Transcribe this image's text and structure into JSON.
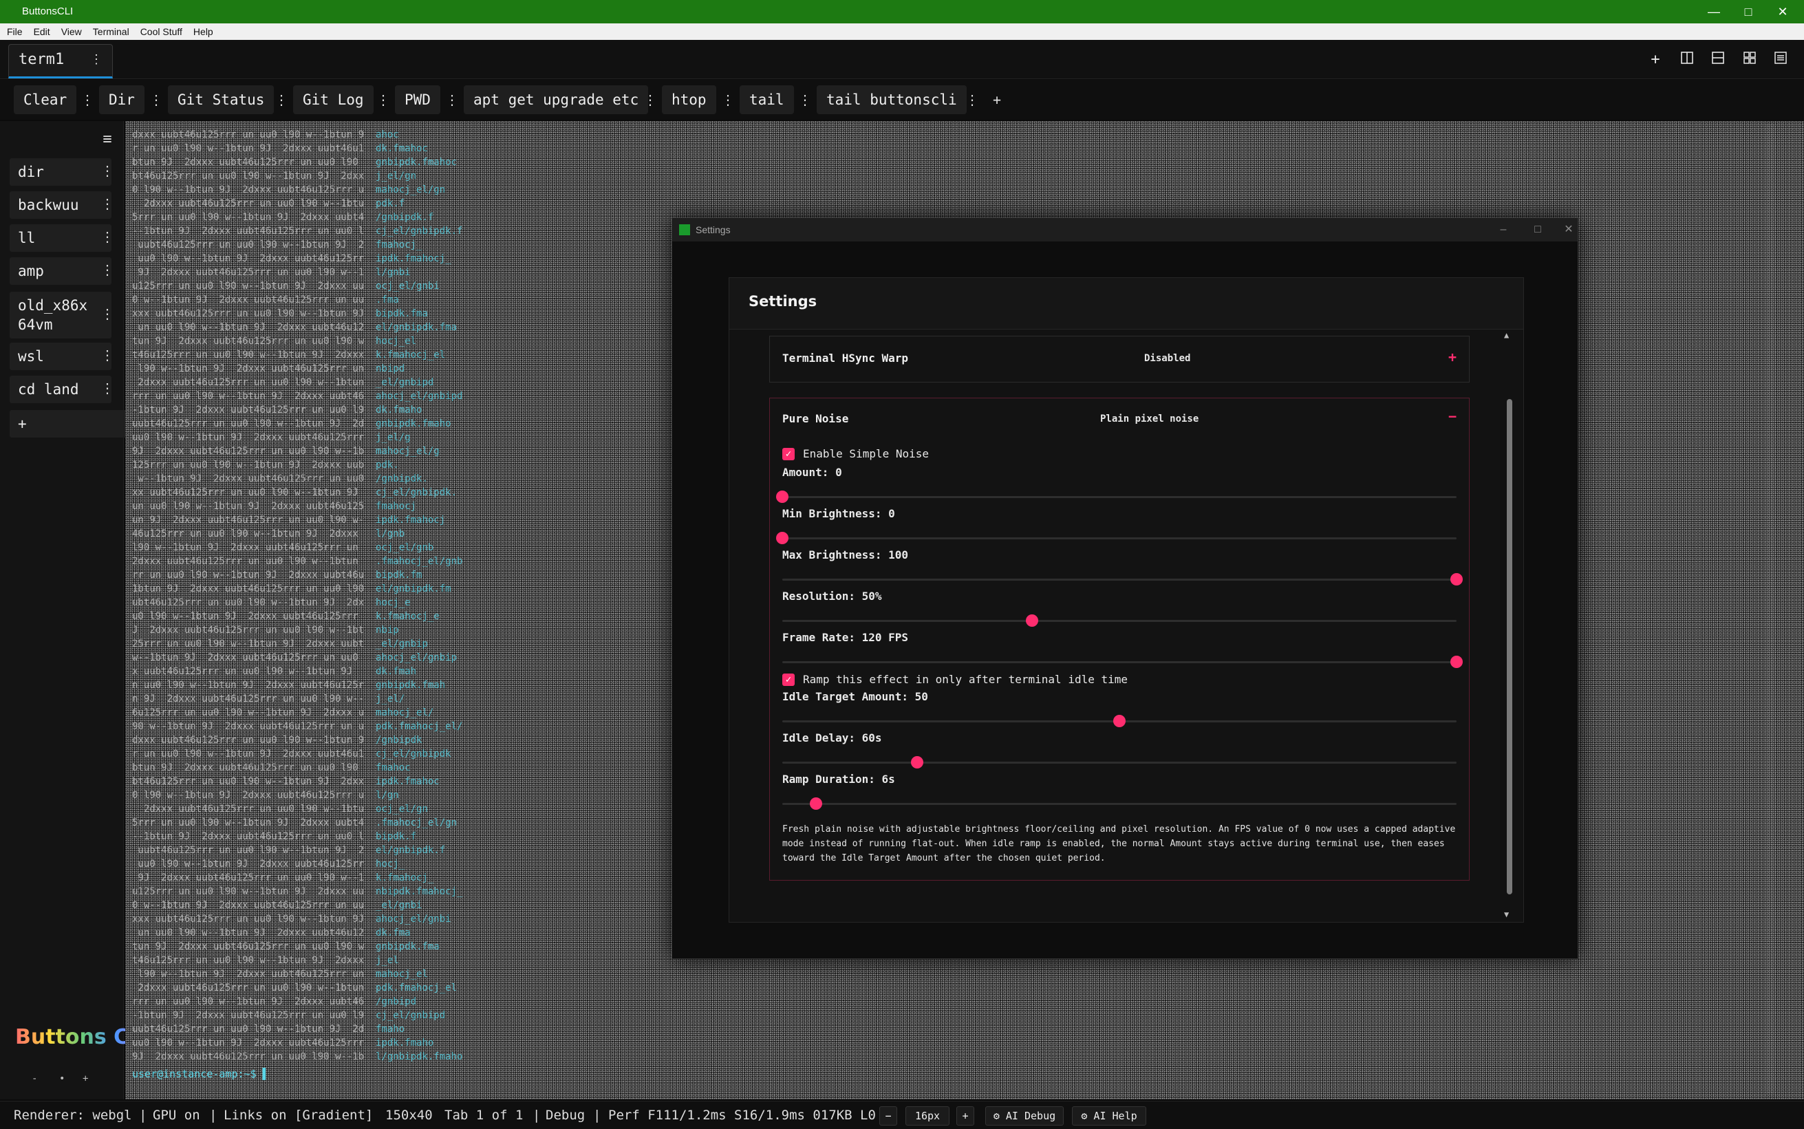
{
  "window": {
    "title": "ButtonsCLI",
    "controls": [
      "—",
      "□",
      "✕"
    ]
  },
  "menu": [
    "File",
    "Edit",
    "View",
    "Terminal",
    "Cool Stuff",
    "Help"
  ],
  "tabs": [
    {
      "label": "term1",
      "menu": "⋮"
    }
  ],
  "toolbar_icons": [
    "new-tab-icon",
    "split-vertical-icon",
    "split-horizontal-icon",
    "grid-layout-icon",
    "settings-list-icon"
  ],
  "buttons": [
    {
      "label": "Clear"
    },
    {
      "label": "Dir"
    },
    {
      "label": "Git Status"
    },
    {
      "label": "Git Log"
    },
    {
      "label": "PWD"
    },
    {
      "label": "apt get upgrade etc"
    },
    {
      "label": "htop"
    },
    {
      "label": "tail"
    },
    {
      "label": "tail buttonscli"
    }
  ],
  "add_button_label": "+",
  "sidebar": {
    "items": [
      {
        "label": "dir"
      },
      {
        "label": "backwuu"
      },
      {
        "label": "ll"
      },
      {
        "label": "amp"
      },
      {
        "label": "old_x86x\n64vm"
      },
      {
        "label": "wsl"
      },
      {
        "label": "cd land"
      }
    ],
    "add_label": "+",
    "logo": "Buttons CLI",
    "zoom": [
      "-",
      "•",
      "+"
    ]
  },
  "terminal": {
    "prompt": "user@instance-amp:~$ ▌"
  },
  "settings": {
    "window_title": "Settings",
    "heading": "Settings",
    "sections": [
      {
        "name": "Terminal HSync Warp",
        "value": "Disabled",
        "toggle": "+"
      },
      {
        "name": "Pure Noise",
        "value": "Plain pixel noise",
        "toggle": "−"
      }
    ],
    "pure_noise": {
      "enable_label": "Enable Simple Noise",
      "enabled": true,
      "sliders": [
        {
          "label": "Amount: 0",
          "fraction": 0.0
        },
        {
          "label": "Min Brightness: 0",
          "fraction": 0.0
        },
        {
          "label": "Max Brightness: 100",
          "fraction": 1.0
        },
        {
          "label": "Resolution: 50%",
          "fraction": 0.37
        },
        {
          "label": "Frame Rate: 120 FPS",
          "fraction": 1.0
        }
      ],
      "ramp_label": "Ramp this effect in only after terminal idle time",
      "ramp_enabled": true,
      "ramp_sliders": [
        {
          "label": "Idle Target Amount: 50",
          "fraction": 0.5
        },
        {
          "label": "Idle Delay: 60s",
          "fraction": 0.2
        },
        {
          "label": "Ramp Duration: 6s",
          "fraction": 0.05
        }
      ],
      "description": "Fresh plain noise with adjustable brightness floor/ceiling and pixel resolution. An FPS value of 0 now uses a capped adaptive mode instead of running flat-out. When idle ramp is enabled, the normal Amount stays active during terminal use, then eases toward the Idle Target Amount after the chosen quiet period."
    }
  },
  "status": {
    "renderer": "Renderer: webgl",
    "gpu": "GPU on",
    "links": "Links on [Gradient]",
    "size": "150x40",
    "tab": "Tab 1 of 1",
    "debug": "Debug",
    "perf": "Perf F111/1.2ms S16/1.9ms 017KB L0",
    "font_minus": "−",
    "font_size": "16px",
    "font_plus": "+",
    "ai_debug": "⚙ AI Debug",
    "ai_help": "⚙ AI Help"
  },
  "colors": {
    "titlebar": "#1d7a12",
    "accent": "#ff2d6f",
    "tab_underline": "#1e8fd8",
    "terminal_name": "#5ad6e8"
  }
}
